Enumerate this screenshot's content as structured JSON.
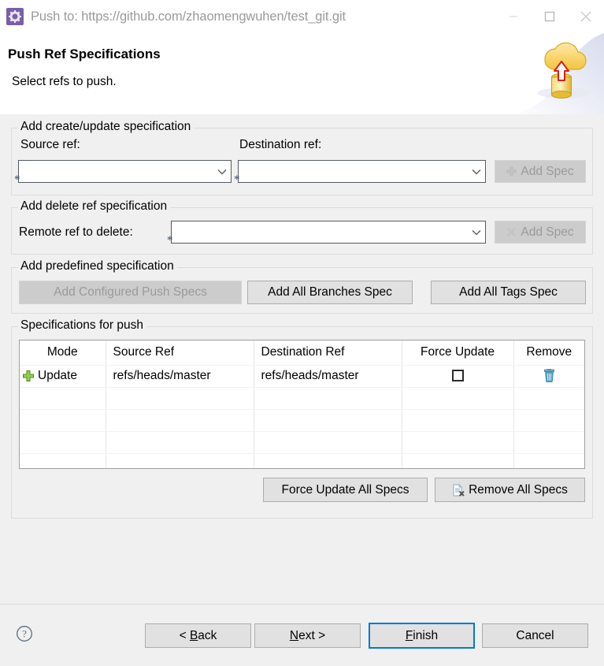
{
  "window": {
    "title": "Push to: https://github.com/zhaomengwuhen/test_git.git",
    "app_icon": "gear-icon",
    "minimize_label": "Minimize",
    "maximize_label": "Maximize",
    "close_label": "Close"
  },
  "header": {
    "title": "Push Ref Specifications",
    "description": "Select refs to push.",
    "banner_icon": "cloud-upload-database-icon"
  },
  "create_update_group": {
    "title": "Add create/update specification",
    "source_label": "Source ref:",
    "source_value": "",
    "source_required_mark": "*",
    "destination_label": "Destination ref:",
    "destination_value": "",
    "destination_required_mark": "*",
    "add_spec_label": "Add Spec",
    "add_spec_icon": "plus-icon",
    "add_spec_disabled": true
  },
  "delete_group": {
    "title": "Add delete ref specification",
    "remote_label": "Remote ref to delete:",
    "remote_value": "",
    "remote_required_mark": "*",
    "add_spec_label": "Add Spec",
    "add_spec_icon": "cross-icon",
    "add_spec_disabled": true
  },
  "predefined_group": {
    "title": "Add predefined specification",
    "buttons": [
      {
        "label": "Add Configured Push Specs",
        "disabled": true
      },
      {
        "label": "Add All Branches Spec",
        "disabled": false
      },
      {
        "label": "Add All Tags Spec",
        "disabled": false
      }
    ]
  },
  "specs_group": {
    "title": "Specifications for push",
    "columns": [
      "Mode",
      "Source Ref",
      "Destination Ref",
      "Force Update",
      "Remove"
    ],
    "rows": [
      {
        "mode_icon": "plus-icon",
        "mode": "Update",
        "source_ref": "refs/heads/master",
        "destination_ref": "refs/heads/master",
        "force_update": false,
        "remove_icon": "trash-icon"
      }
    ],
    "empty_row_count": 4,
    "force_update_all_label": "Force Update All Specs",
    "remove_all_label": "Remove All Specs",
    "remove_all_icon": "document-delete-icon"
  },
  "footer": {
    "help_icon": "help-question-icon",
    "buttons": [
      {
        "name": "back",
        "prefix": "< ",
        "mnemonic": "B",
        "rest": "ack",
        "suffix": "",
        "default": false
      },
      {
        "name": "next",
        "prefix": "",
        "mnemonic": "N",
        "rest": "ext",
        "suffix": " >",
        "default": false
      },
      {
        "name": "finish",
        "prefix": "",
        "mnemonic": "F",
        "rest": "inish",
        "suffix": "",
        "default": true
      },
      {
        "name": "cancel",
        "prefix": "Cancel",
        "mnemonic": "",
        "rest": "",
        "suffix": "",
        "default": false
      }
    ]
  },
  "colors": {
    "accent": "#0078d7",
    "window_bg": "#f0f0f0",
    "header_bg": "#ffffff",
    "title_text": "#9a9a9a",
    "disabled_text": "#9a9a9a",
    "plus_green": "#73c043",
    "trash_blue": "#3d8fb5",
    "required_mark": "#3b4a6b"
  }
}
